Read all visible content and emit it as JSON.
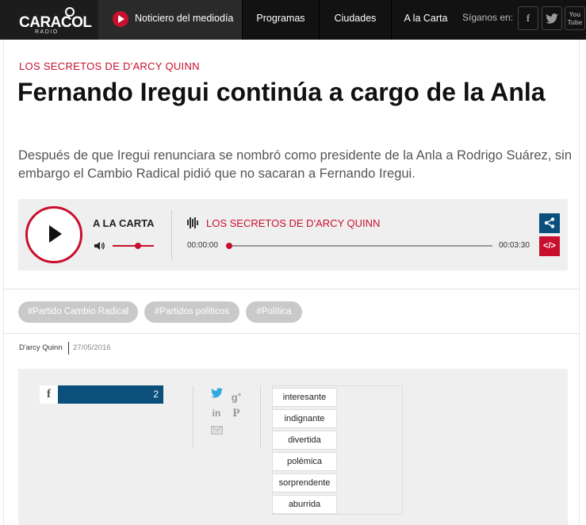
{
  "nav": {
    "logo_text": "CARACOL",
    "logo_sub": "RADIO",
    "live_label": "Noticiero del mediodía",
    "items": [
      "Programas",
      "Ciudades",
      "A la Carta"
    ],
    "follow_label": "Síganos en:",
    "social_fb": "f",
    "social_yt": "You Tube"
  },
  "article": {
    "section": "LOS SECRETOS DE D'ARCY QUINN",
    "headline": "Fernando Iregui continúa a cargo de la Anla",
    "subtitle": "Después de que Iregui renunciara se nombró como presidente de la Anla a Rodrigo Suárez, sin embargo el Cambio Radical pidió que no sacaran a Fernando Iregui."
  },
  "player": {
    "label": "A LA CARTA",
    "program": "LOS SECRETOS DE D'ARCY QUINN",
    "current_time": "00:00:00",
    "duration": "00:03:30",
    "progress": 0,
    "volume": 0.7,
    "embed_label": "</>"
  },
  "tags": [
    "#Partido Cambio Radical",
    "#Partidos políticos",
    "#Política"
  ],
  "byline": {
    "author": "D'arcy Quinn",
    "date": "27/05/2016"
  },
  "share": {
    "facebook_icon": "f",
    "facebook_count": "2",
    "icons": [
      "twitter-icon",
      "google-plus-icon",
      "linkedin-icon",
      "pinterest-icon",
      "email-icon"
    ]
  },
  "reactions": [
    "interesante",
    "indignante",
    "divertida",
    "polémica",
    "sorprendente",
    "aburrida"
  ],
  "colors": {
    "accent_red": "#c8102e",
    "accent_blue": "#0b4f7c",
    "nav_bg": "#121212",
    "tag_bg": "#c9c9c9",
    "panel_bg": "#efefef"
  }
}
